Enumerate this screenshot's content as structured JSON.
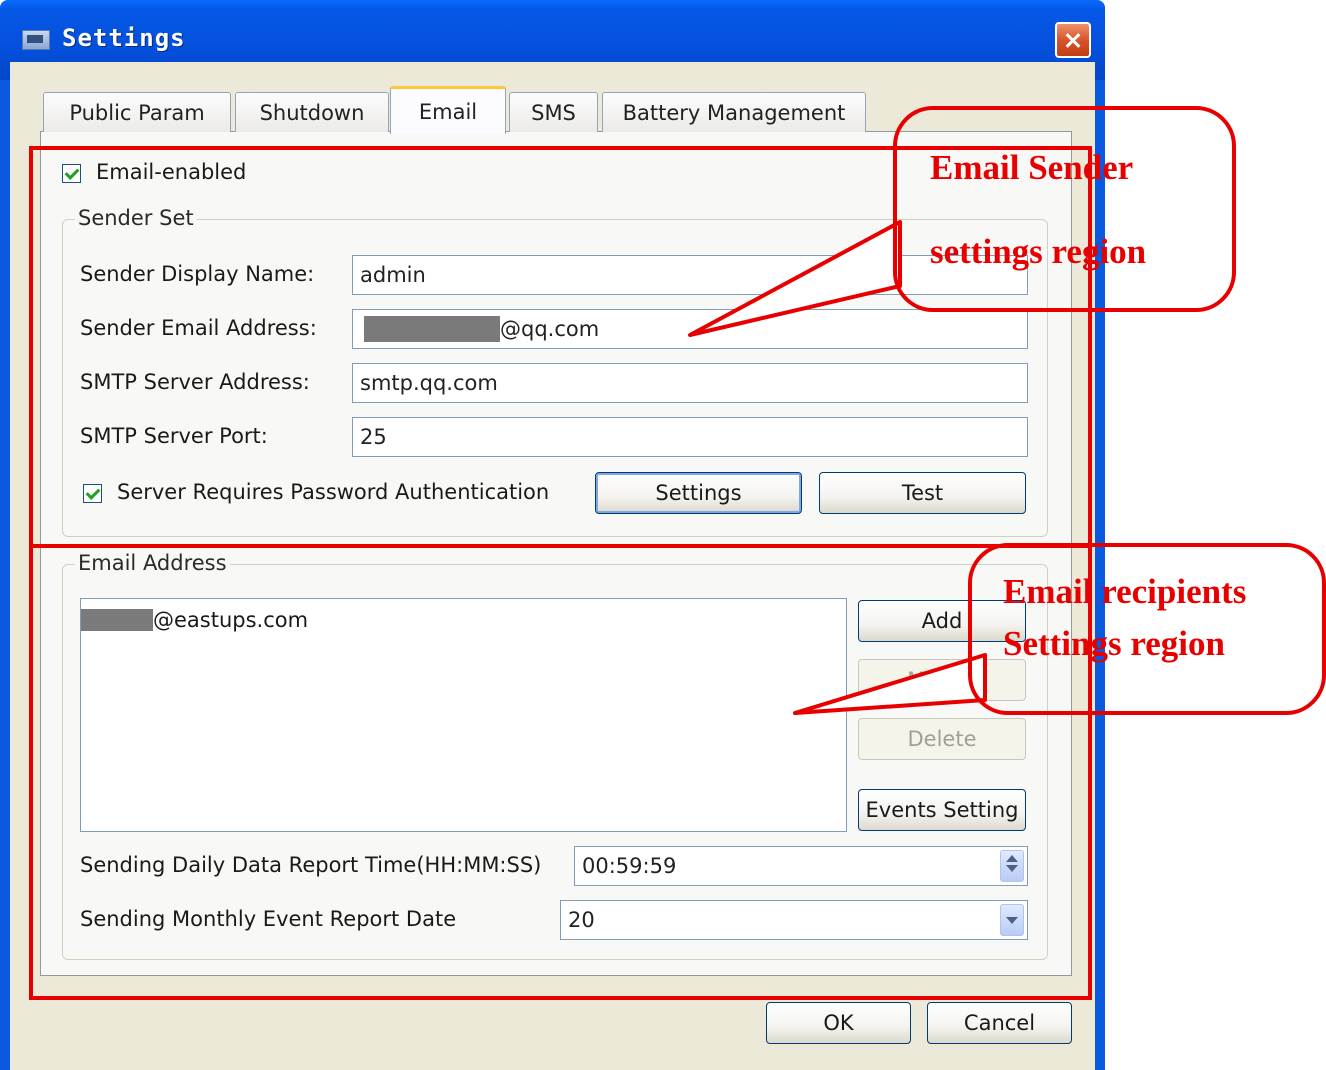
{
  "window": {
    "title": "Settings"
  },
  "tabs": [
    {
      "label": "Public Param",
      "active": false
    },
    {
      "label": "Shutdown",
      "active": false
    },
    {
      "label": "Email",
      "active": true
    },
    {
      "label": "SMS",
      "active": false
    },
    {
      "label": "Battery Management",
      "active": false
    }
  ],
  "email_enabled": {
    "label": "Email-enabled",
    "checked": true
  },
  "sender_set": {
    "group_label": "Sender Set",
    "display_name": {
      "label": "Sender Display Name:",
      "value": "admin"
    },
    "email_address": {
      "label": "Sender Email Address:",
      "value": "@qq.com"
    },
    "smtp_address": {
      "label": "SMTP Server Address:",
      "value": "smtp.qq.com"
    },
    "smtp_port": {
      "label": "SMTP Server Port:",
      "value": "25"
    },
    "password_auth": {
      "label": "Server Requires Password Authentication",
      "checked": true
    },
    "settings_button": "Settings",
    "test_button": "Test"
  },
  "email_address_group": {
    "group_label": "Email Address",
    "recipients": [
      "@eastups.com"
    ],
    "add_button": "Add",
    "modify_button": "Modify",
    "delete_button": "Delete",
    "events_button": "Events Setting",
    "daily_report": {
      "label": "Sending Daily Data Report Time(HH:MM:SS)",
      "value": "00:59:59"
    },
    "monthly_report": {
      "label": "Sending Monthly Event Report Date",
      "value": "20"
    }
  },
  "footer": {
    "ok_button": "OK",
    "cancel_button": "Cancel"
  },
  "annotations": {
    "sender_callout_line1": "Email Sender",
    "sender_callout_line2": "settings region",
    "recipients_callout_line1": "Email recipients",
    "recipients_callout_line2": "Settings region",
    "color": "#e80000"
  },
  "colors": {
    "titlebar": "#0558e6",
    "dialog_bg": "#ece9d8",
    "active_tab_accent": "#ffc83c"
  }
}
